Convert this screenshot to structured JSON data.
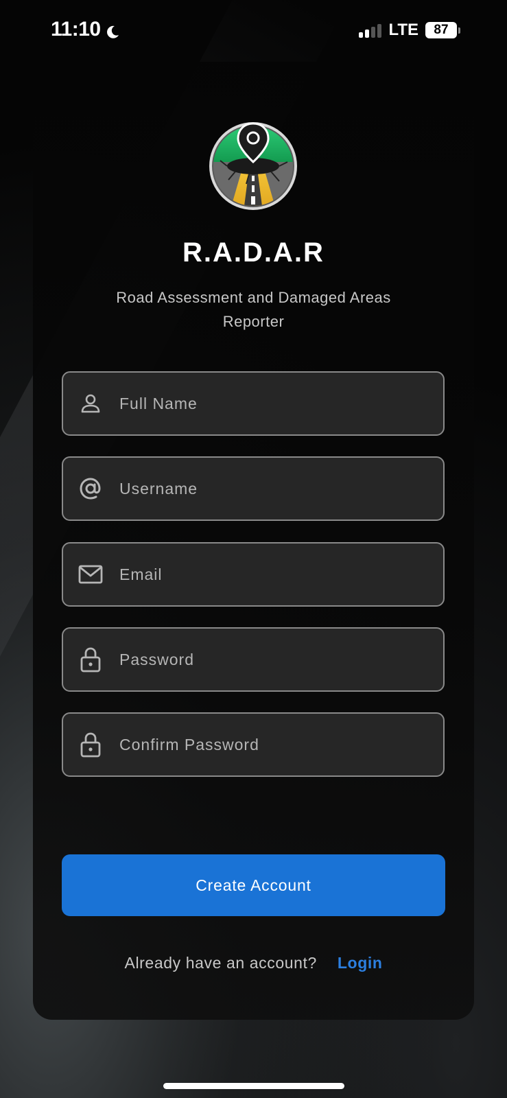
{
  "status_bar": {
    "time": "11:10",
    "network": "LTE",
    "battery": "87"
  },
  "app": {
    "title": "R.A.D.A.R",
    "subtitle": "Road Assessment and Damaged Areas Reporter",
    "logo_icon": "map-pin-pothole-road-logo"
  },
  "form": {
    "fields": [
      {
        "icon": "person-icon",
        "placeholder": "Full Name",
        "value": ""
      },
      {
        "icon": "at-sign-icon",
        "placeholder": "Username",
        "value": ""
      },
      {
        "icon": "envelope-icon",
        "placeholder": "Email",
        "value": ""
      },
      {
        "icon": "lock-icon",
        "placeholder": "Password",
        "value": ""
      },
      {
        "icon": "lock-icon",
        "placeholder": "Confirm Password",
        "value": ""
      }
    ],
    "submit_label": "Create Account"
  },
  "footer": {
    "prompt": "Already have an account?",
    "login_label": "Login"
  },
  "colors": {
    "accent": "#1a73d6",
    "link": "#2c7fe0",
    "field_bg": "#262626",
    "field_border": "#8a8a8a"
  }
}
